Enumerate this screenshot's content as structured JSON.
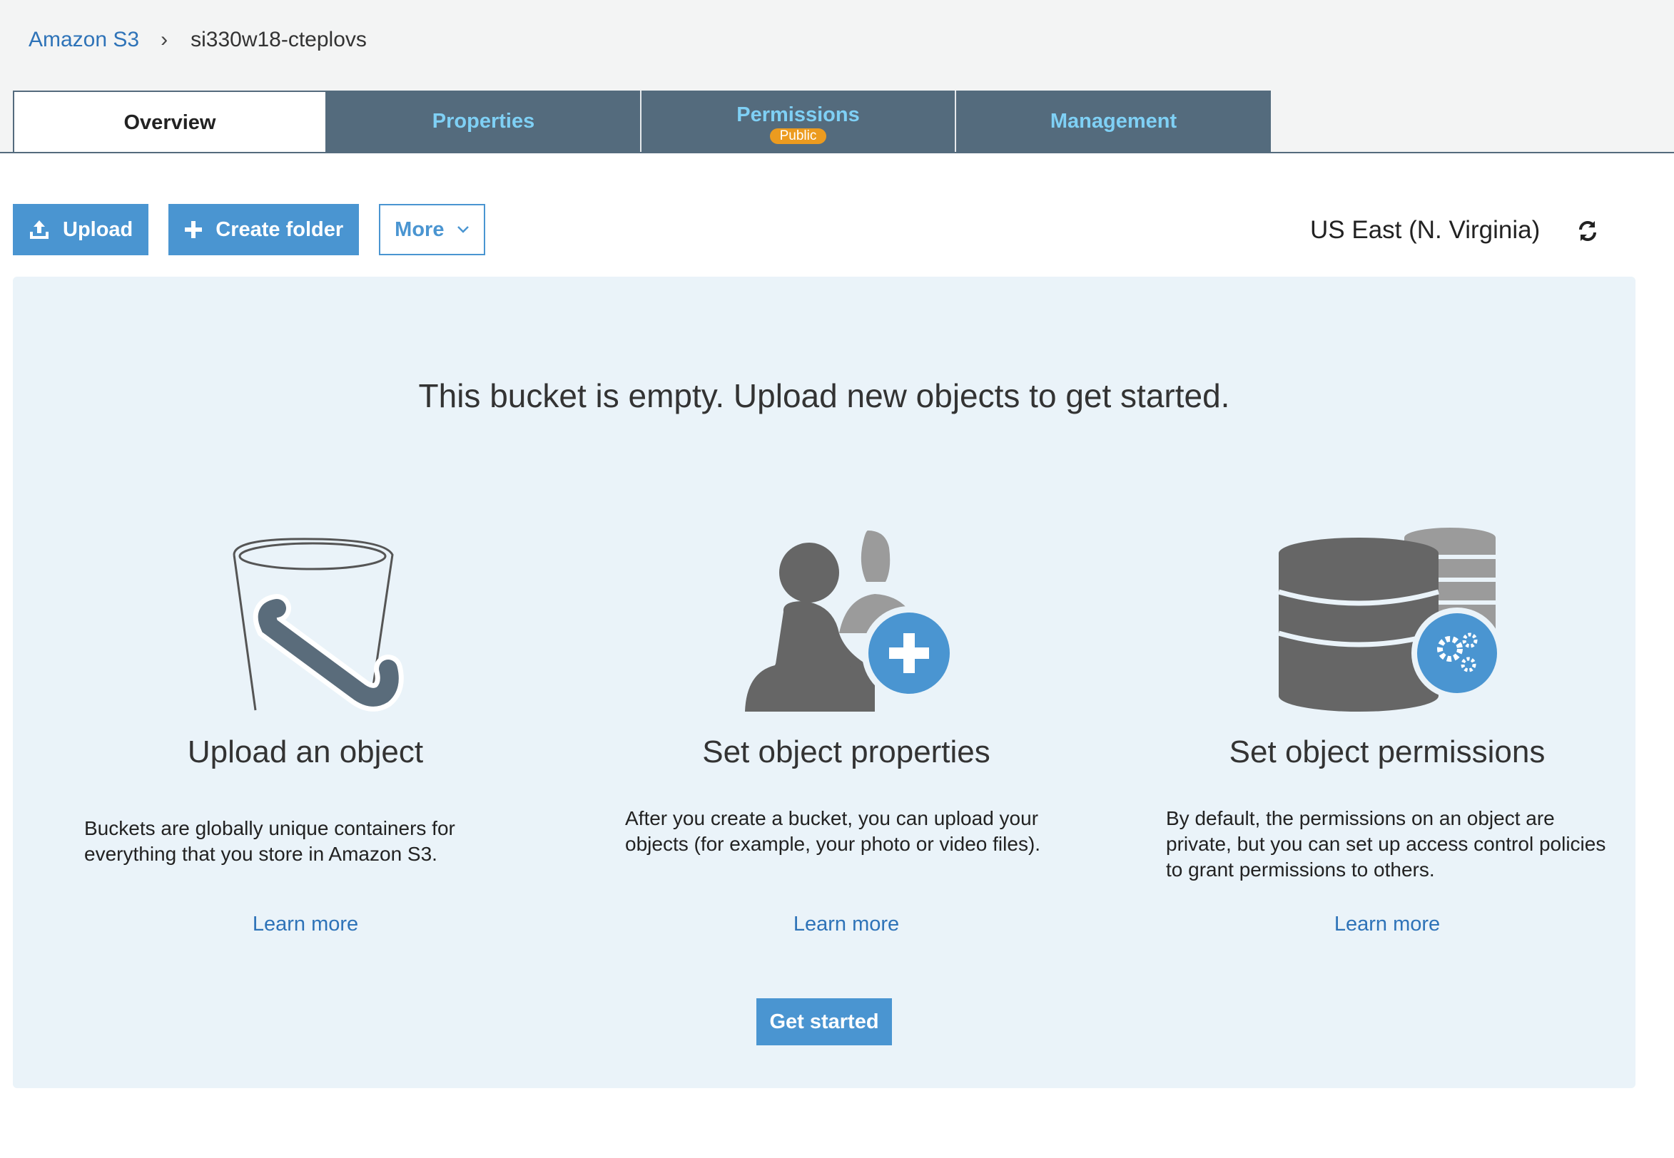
{
  "breadcrumb": {
    "root": "Amazon S3",
    "separator": "›",
    "current": "si330w18-cteplovs"
  },
  "tabs": [
    {
      "label": "Overview",
      "active": true
    },
    {
      "label": "Properties"
    },
    {
      "label": "Permissions",
      "badge": "Public"
    },
    {
      "label": "Management"
    }
  ],
  "toolbar": {
    "upload_label": "Upload",
    "create_folder_label": "Create folder",
    "more_label": "More"
  },
  "region": "US East (N. Virginia)",
  "empty_state": {
    "headline": "This bucket is empty. Upload new objects to get started.",
    "cards": [
      {
        "title": "Upload an object",
        "text": "Buckets are globally unique containers for everything that you store in Amazon S3.",
        "link": "Learn more",
        "icon": "bucket-icon"
      },
      {
        "title": "Set object properties",
        "text": "After you create a bucket, you can upload your objects (for example, your photo or video files).",
        "link": "Learn more",
        "icon": "users-add-icon"
      },
      {
        "title": "Set object permissions",
        "text": "By default, the permissions on an object are private, but you can set up access control policies to grant permissions to others.",
        "link": "Learn more",
        "icon": "database-settings-icon"
      }
    ],
    "cta": "Get started"
  },
  "colors": {
    "accent": "#4a95d1",
    "link": "#2e73b8",
    "tab_bg": "#546b7d",
    "tab_text": "#7fd0f5",
    "panel_bg": "#eaf3f9",
    "badge": "#ec9b1f"
  }
}
